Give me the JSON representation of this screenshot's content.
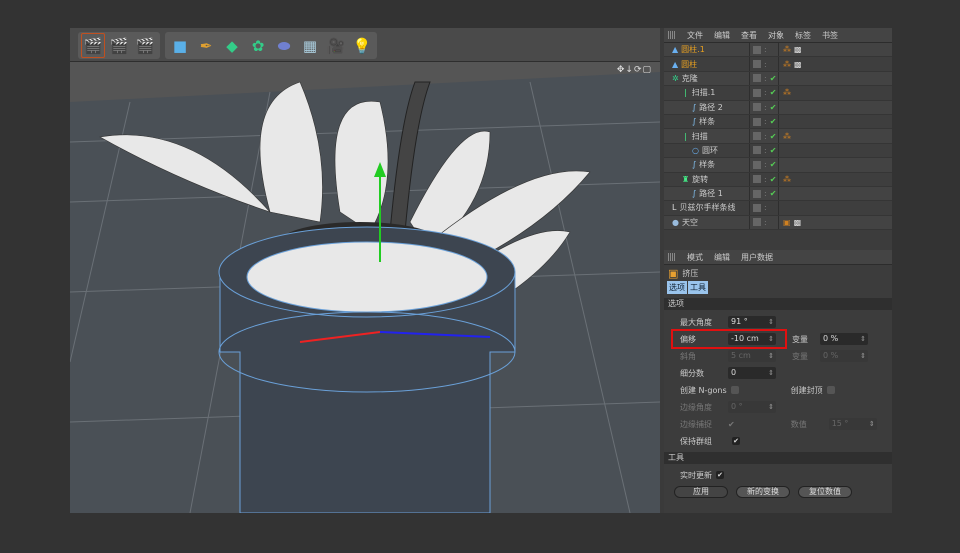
{
  "toolbar": {
    "icons": [
      "render-view-icon",
      "render-picture-viewer-icon",
      "render-settings-icon",
      "cube-icon",
      "pen-spline-icon",
      "subdivision-icon",
      "array-icon",
      "deformer-icon",
      "floor-icon",
      "camera-icon",
      "light-icon"
    ]
  },
  "object_manager": {
    "menu": [
      "文件",
      "编辑",
      "查看",
      "对象",
      "标签",
      "书签"
    ],
    "objects": [
      {
        "name": "圆柱.1",
        "icon": "cylinder-icon",
        "selected": true,
        "checked": false,
        "tags": [
          "phong-tag",
          "texture-tag"
        ]
      },
      {
        "name": "圆柱",
        "icon": "cylinder-icon",
        "selected": true,
        "checked": false,
        "tags": [
          "phong-tag",
          "texture-tag"
        ]
      },
      {
        "name": "克隆",
        "icon": "cloner-icon",
        "checked": true,
        "tags": []
      },
      {
        "name": "扫描.1",
        "icon": "sweep-icon",
        "checked": true,
        "tags": [
          "phong-tag"
        ]
      },
      {
        "name": "路径 2",
        "icon": "spline-icon",
        "checked": true,
        "tags": []
      },
      {
        "name": "样条",
        "icon": "spline-icon",
        "checked": true,
        "tags": []
      },
      {
        "name": "扫描",
        "icon": "sweep-icon",
        "checked": true,
        "tags": [
          "phong-tag"
        ]
      },
      {
        "name": "圆环",
        "icon": "circle-icon",
        "checked": true,
        "tags": []
      },
      {
        "name": "样条",
        "icon": "spline-icon",
        "checked": true,
        "tags": []
      },
      {
        "name": "旋转",
        "icon": "lathe-icon",
        "checked": true,
        "tags": [
          "phong-tag"
        ]
      },
      {
        "name": "路径 1",
        "icon": "spline-icon",
        "checked": true,
        "tags": []
      },
      {
        "name": "贝兹尔手样条线",
        "icon": "bezier-icon",
        "checked": false,
        "tags": []
      },
      {
        "name": "天空",
        "icon": "sky-icon",
        "checked": false,
        "tags": [
          "compositing-tag",
          "texture-tag"
        ]
      }
    ]
  },
  "attributes": {
    "menu": [
      "模式",
      "编辑",
      "用户数据"
    ],
    "title": "挤压",
    "tabs": [
      "选项",
      "工具"
    ],
    "section_options": "选项",
    "max_angle": {
      "label": "最大角度",
      "value": "91 °"
    },
    "offset": {
      "label": "偏移",
      "value": "-10 cm"
    },
    "variance1": {
      "label": "变量",
      "value": "0 %"
    },
    "bevel": {
      "label": "斜角",
      "value": "5 cm"
    },
    "variance2": {
      "label": "变量",
      "value": "0 %"
    },
    "subdivision": {
      "label": "细分数",
      "value": "0"
    },
    "create_ngons": {
      "label": "创建 N-gons",
      "checked": false
    },
    "create_caps": {
      "label": "创建封顶",
      "checked": false
    },
    "edge_angle": {
      "label": "边缘角度",
      "value": "0 °"
    },
    "edge_snap": {
      "label": "边缘捕捉",
      "checked": true
    },
    "value": {
      "label": "数值",
      "value": "15 °"
    },
    "keep_groups": {
      "label": "保持群组",
      "checked": true
    },
    "section_tool": "工具",
    "realtime_update": {
      "label": "实时更新",
      "checked": true
    },
    "buttons": {
      "apply": "应用",
      "new_transform": "新的变换",
      "reset_values": "复位数值"
    },
    "highlight_color": "#e01010"
  }
}
